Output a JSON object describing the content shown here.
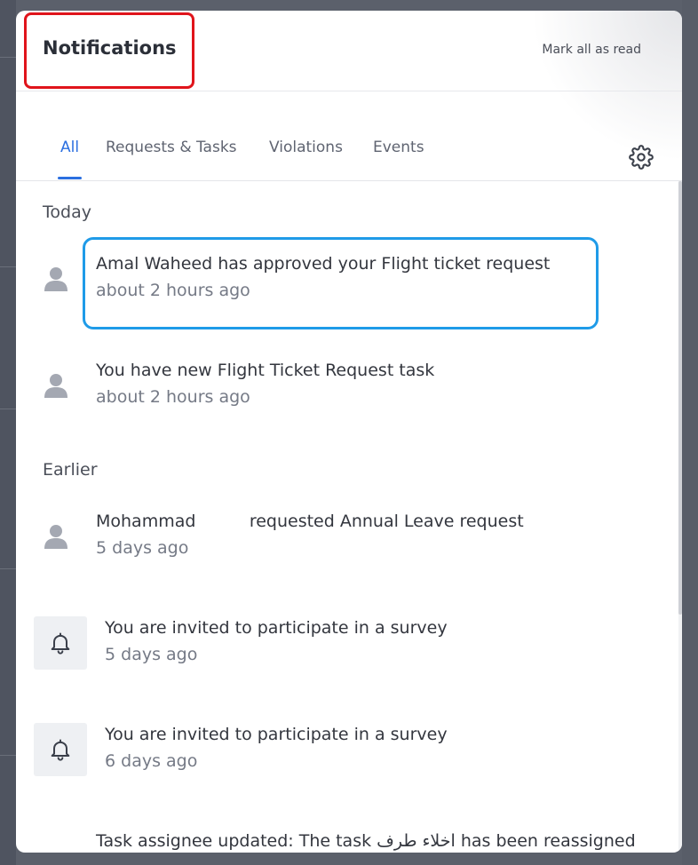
{
  "header": {
    "title": "Notifications",
    "mark_all_read": "Mark all as read"
  },
  "tabs": [
    {
      "label": "All",
      "active": true
    },
    {
      "label": "Requests & Tasks",
      "active": false
    },
    {
      "label": "Violations",
      "active": false
    },
    {
      "label": "Events",
      "active": false
    }
  ],
  "sections": {
    "today": "Today",
    "earlier": "Earlier"
  },
  "notifications": [
    {
      "icon": "person-icon",
      "text": "Amal Waheed has approved your Flight ticket request",
      "time": "about 2 hours ago"
    },
    {
      "icon": "person-icon",
      "text": "You have new Flight Ticket Request task",
      "time": "about 2 hours ago"
    },
    {
      "icon": "person-icon",
      "text": "Mohammad          requested Annual Leave request",
      "time": "5 days ago"
    },
    {
      "icon": "bell-icon",
      "text": "You are invited to participate in a survey",
      "time": "5 days ago"
    },
    {
      "icon": "bell-icon",
      "text": "You are invited to participate in a survey",
      "time": "6 days ago"
    },
    {
      "icon": "none",
      "text": "Task assignee updated: The task اخلاء طرف has been reassigned",
      "time": ""
    }
  ],
  "colors": {
    "accent": "#2b6fe0",
    "title_highlight": "#e0141b",
    "item_highlight": "#1f9be8"
  }
}
